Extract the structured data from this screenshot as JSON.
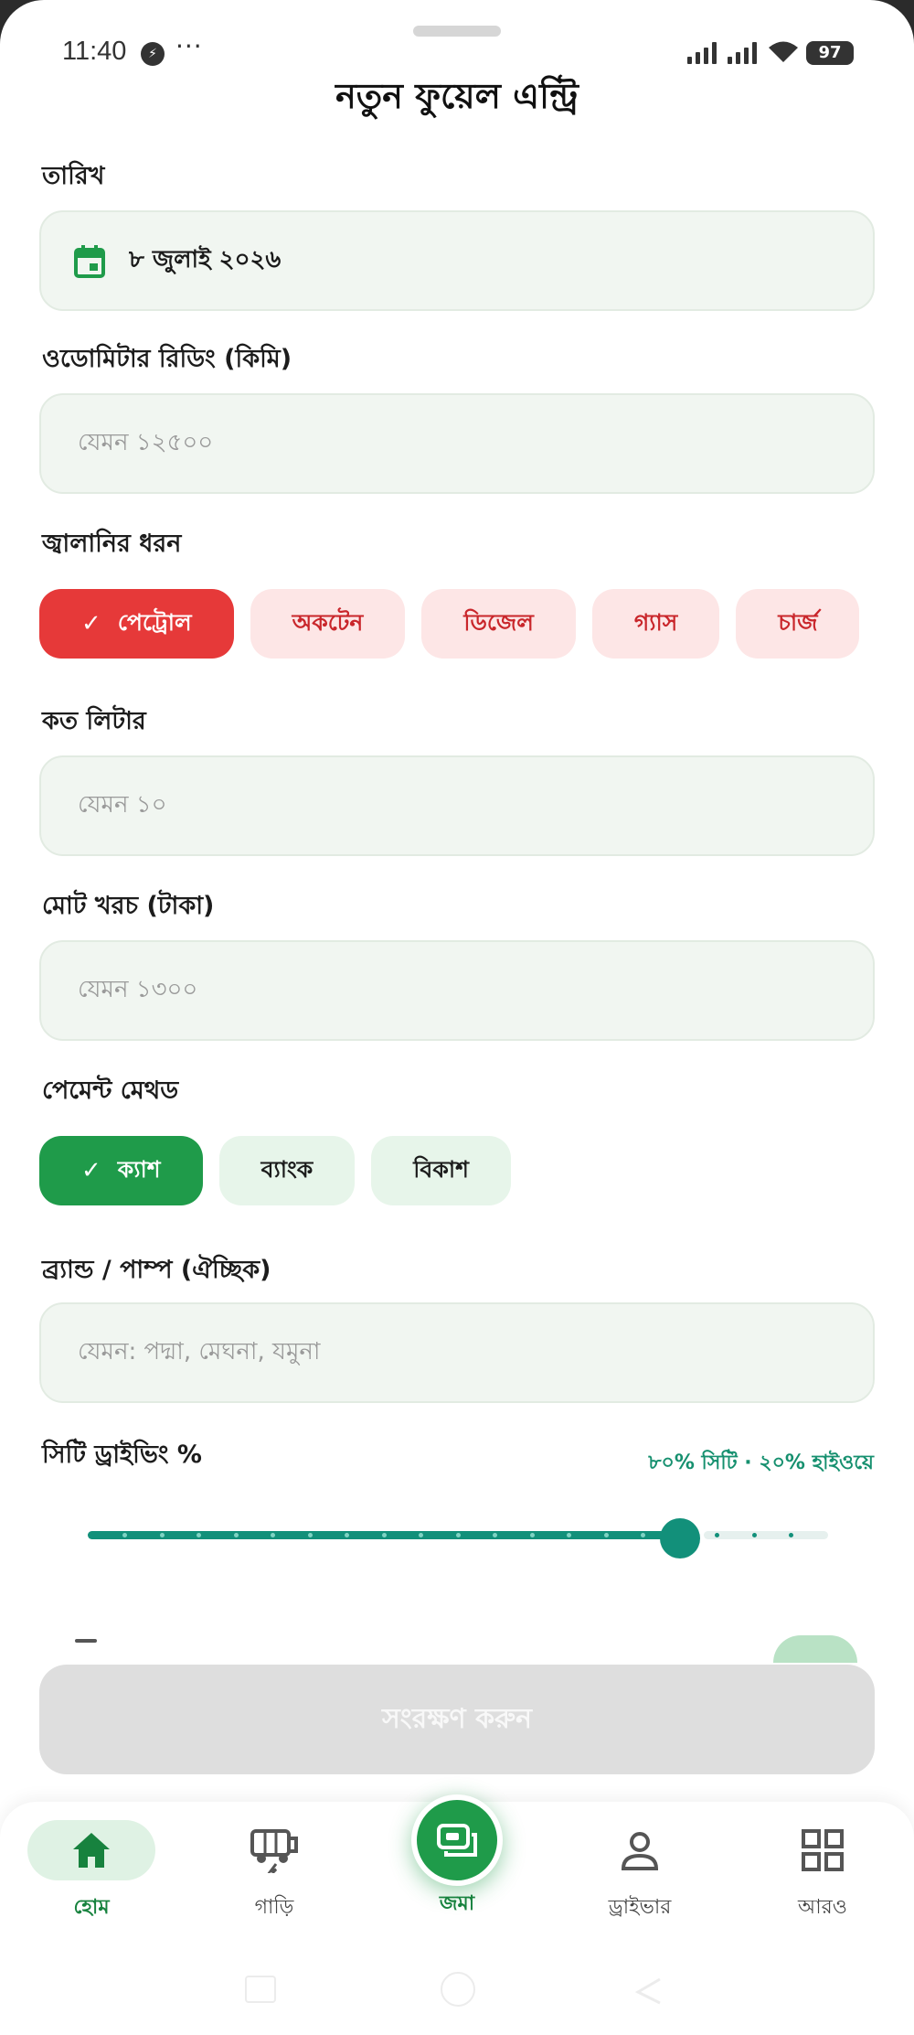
{
  "status_bar": {
    "time": "11:40",
    "battery": "97",
    "dots": "···"
  },
  "header": {
    "title": "নতুন ফুয়েল এন্ট্রি"
  },
  "form": {
    "date": {
      "label": "তারিখ",
      "value": "৮ জুলাই ২০২৬",
      "icon": "calendar-icon"
    },
    "odometer": {
      "label": "ওডোমিটার রিডিং (কিমি)",
      "placeholder": "যেমন ১২৫০০"
    },
    "fuel_type": {
      "label": "জ্বালানির ধরন",
      "options": [
        "পেট্রোল",
        "অকটেন",
        "ডিজেল",
        "গ্যাস",
        "চার্জ"
      ],
      "selected": "পেট্রোল"
    },
    "liters": {
      "label": "কত লিটার",
      "placeholder": "যেমন ১০"
    },
    "total_cost": {
      "label": "মোট খরচ (টাকা)",
      "placeholder": "যেমন ১৩০০"
    },
    "payment_method": {
      "label": "পেমেন্ট মেথড",
      "options": [
        "ক্যাশ",
        "ব্যাংক",
        "বিকাশ"
      ],
      "selected": "ক্যাশ"
    },
    "brand": {
      "label": "ব্র্যান্ড / পাম্প (ঐচ্ছিক)",
      "placeholder": "যেমন: পদ্মা, মেঘনা, যমুনা"
    },
    "city_driving": {
      "label": "সিটি ড্রাইভিং %",
      "summary": "৮০% সিটি · ২০% হাইওয়ে",
      "value_percent": 80,
      "step_count": 20
    }
  },
  "save_button": {
    "label": "সংরক্ষণ করুন"
  },
  "bottom_nav": {
    "items": [
      {
        "label": "হোম",
        "icon": "home-icon",
        "active": true
      },
      {
        "label": "গাড়ি",
        "icon": "vehicle-icon",
        "active": false
      },
      {
        "label": "জমা",
        "icon": "deposit-icon",
        "active": false
      },
      {
        "label": "ড্রাইভার",
        "icon": "person-icon",
        "active": false
      },
      {
        "label": "আরও",
        "icon": "grid-icon",
        "active": false
      }
    ]
  },
  "colors": {
    "accent_green": "#1f9b4a",
    "accent_red": "#e63939",
    "teal": "#12907a"
  }
}
